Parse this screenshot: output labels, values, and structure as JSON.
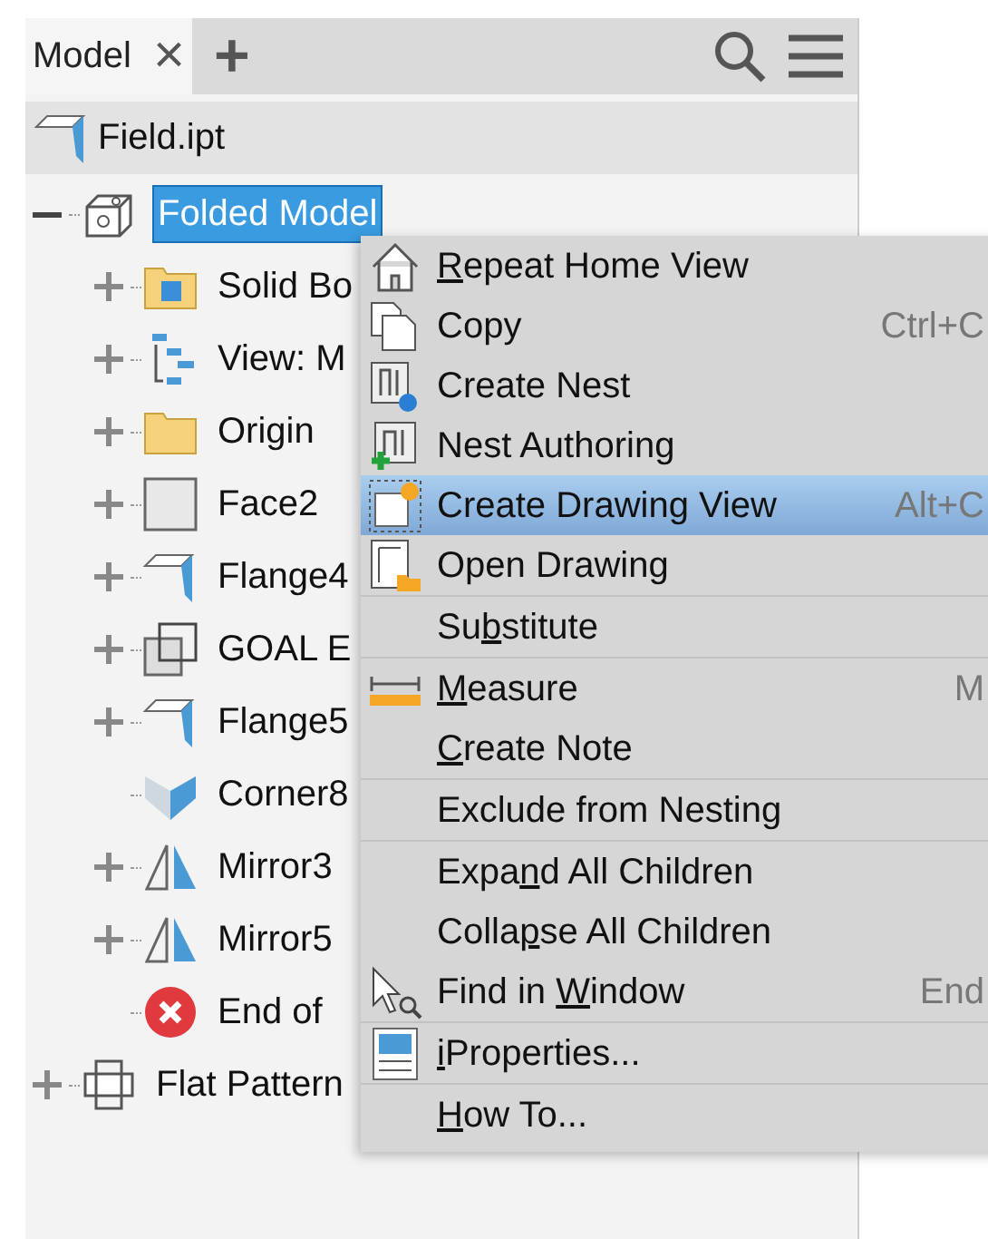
{
  "panel": {
    "tab": {
      "label": "Model",
      "close": "×"
    },
    "add": "+"
  },
  "root": {
    "label": "Field.ipt"
  },
  "tree": [
    {
      "label": "Folded Model",
      "kind": "folded",
      "expanded": true,
      "selected": true,
      "children": [
        {
          "label": "Solid Bo",
          "kind": "solids",
          "expanded": false,
          "selected": false
        },
        {
          "label": "View: M",
          "kind": "view",
          "expanded": false,
          "selected": false
        },
        {
          "label": "Origin",
          "kind": "folder",
          "expanded": false,
          "selected": false
        },
        {
          "label": "Face2",
          "kind": "face",
          "expanded": false,
          "selected": false
        },
        {
          "label": "Flange4",
          "kind": "flange",
          "expanded": false,
          "selected": false
        },
        {
          "label": "GOAL E",
          "kind": "edge",
          "expanded": false,
          "selected": false
        },
        {
          "label": "Flange5",
          "kind": "flange",
          "expanded": false,
          "selected": false
        },
        {
          "label": "Corner8",
          "kind": "corner",
          "selected": false
        },
        {
          "label": "Mirror3",
          "kind": "mirror",
          "expanded": false,
          "selected": false
        },
        {
          "label": "Mirror5",
          "kind": "mirror",
          "expanded": false,
          "selected": false
        },
        {
          "label": "End of",
          "kind": "end",
          "selected": false
        }
      ]
    },
    {
      "label": "Flat Pattern",
      "kind": "flat",
      "expanded": false,
      "selected": false
    }
  ],
  "menu": {
    "groups": [
      [
        {
          "key": "R",
          "after": "epeat Home View",
          "kind": "home",
          "selected": false
        },
        {
          "label": "Copy",
          "kind": "copy",
          "shortcut": "Ctrl+C",
          "selected": false
        },
        {
          "label": "Create Nest",
          "kind": "nest",
          "selected": false
        },
        {
          "label": "Nest Authoring",
          "kind": "nestauth",
          "selected": false
        },
        {
          "label": "Create Drawing View",
          "kind": "drawview",
          "shortcut": "Alt+C",
          "selected": true
        },
        {
          "label": "Open Drawing",
          "kind": "opendraw",
          "selected": false
        }
      ],
      [
        {
          "before": "Su",
          "key": "b",
          "after": "stitute",
          "selected": false
        }
      ],
      [
        {
          "key": "M",
          "after": "easure",
          "kind": "measure",
          "shortcut": "M",
          "selected": false
        },
        {
          "key": "C",
          "after": "reate Note",
          "selected": false
        }
      ],
      [
        {
          "label": "Exclude from Nesting",
          "selected": false
        }
      ],
      [
        {
          "before": "Expa",
          "key": "n",
          "after": "d All Children",
          "selected": false
        },
        {
          "before": "Colla",
          "key": "p",
          "after": "se All Children",
          "selected": false
        },
        {
          "before": "Find in ",
          "key": "W",
          "after": "indow",
          "kind": "find",
          "shortcut": "End",
          "selected": false
        }
      ],
      [
        {
          "key": "i",
          "after": "Properties...",
          "kind": "props",
          "selected": false
        }
      ],
      [
        {
          "key": "H",
          "after": "ow To...",
          "selected": false
        }
      ]
    ]
  }
}
